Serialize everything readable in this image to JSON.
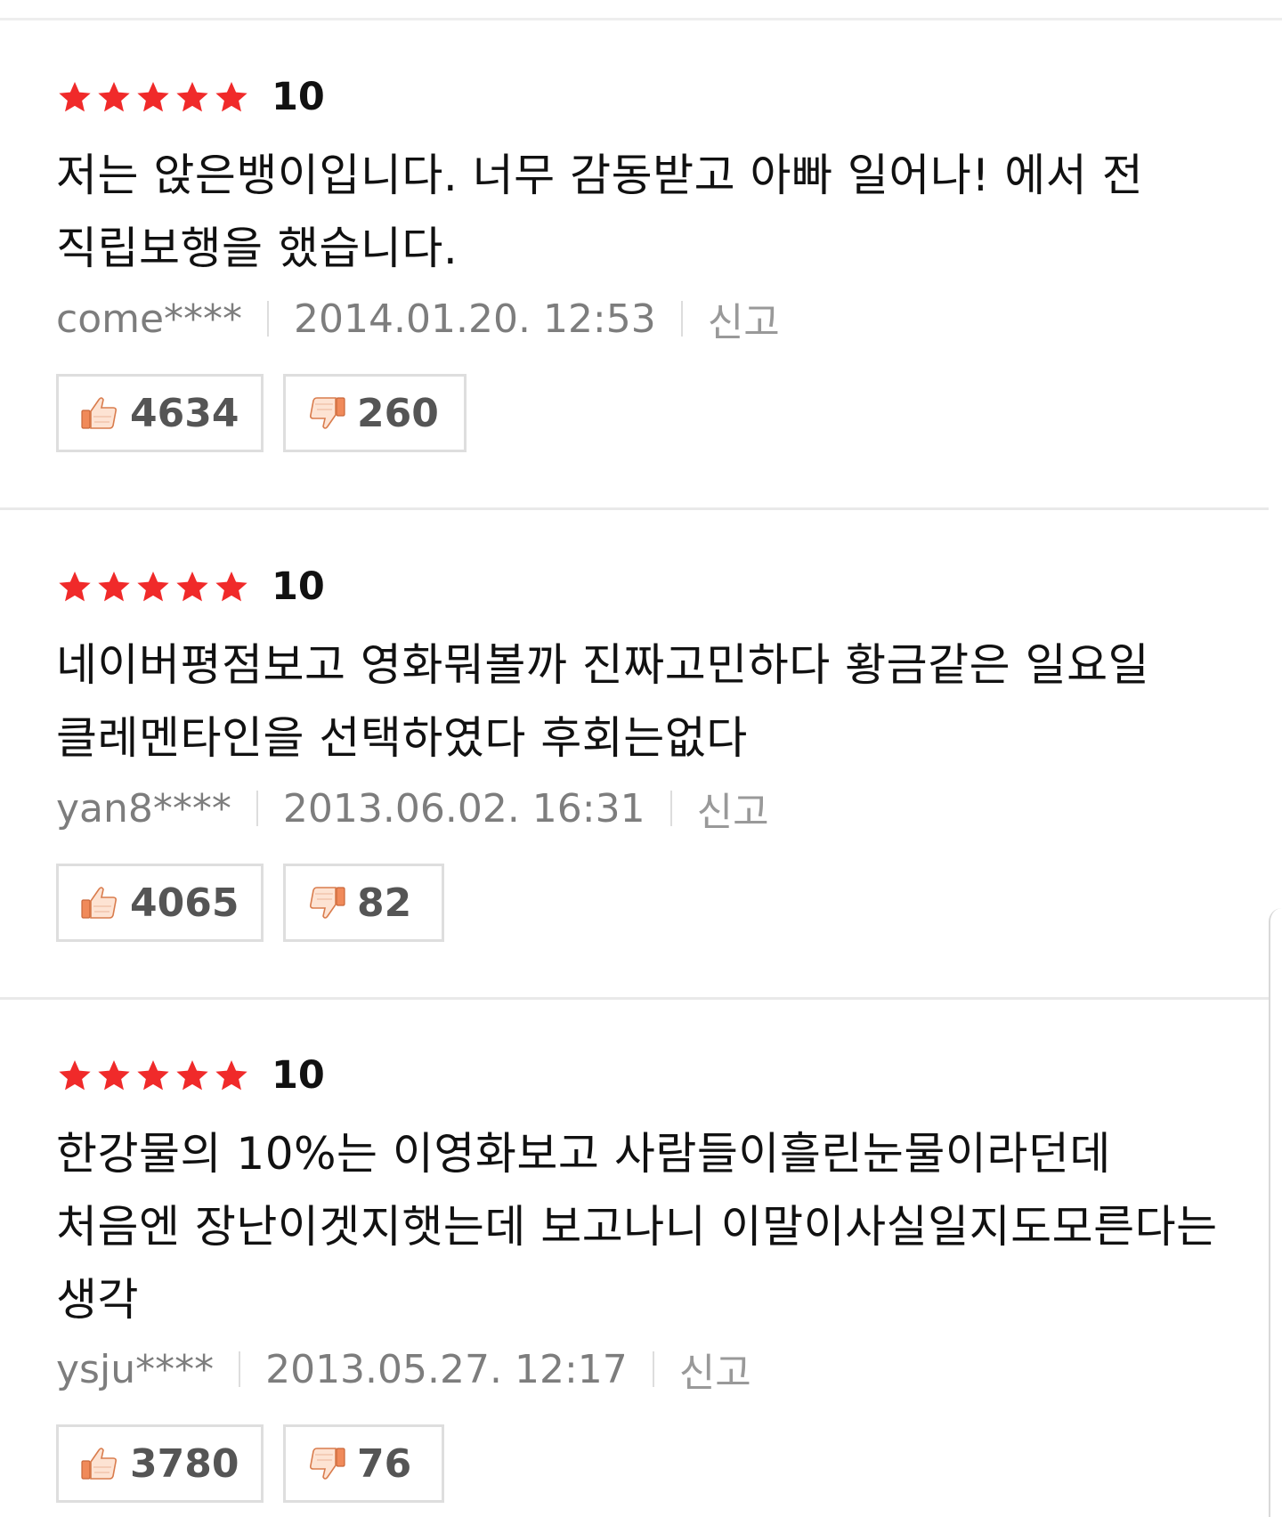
{
  "colors": {
    "star": "#f02a2a",
    "text": "#111111",
    "meta": "#7d7d7d",
    "thumb": "#f08a5a"
  },
  "icons": {
    "star": "star-icon",
    "like": "thumbs-up-icon",
    "dislike": "thumbs-down-icon"
  },
  "reviews": [
    {
      "stars": 5,
      "score": "10",
      "comment": "저는 앉은뱅이입니다. 너무 감동받고 아빠 일어나! 에서 전 직립보행을 했습니다.",
      "user": "come****",
      "date": "2014.01.20. 12:53",
      "report": "신고",
      "likes": "4634",
      "dislikes": "260"
    },
    {
      "stars": 5,
      "score": "10",
      "comment": "네이버평점보고 영화뭐볼까 진짜고민하다 황금같은 일요일 클레멘타인을 선택하였다 후회는없다",
      "user": "yan8****",
      "date": "2013.06.02. 16:31",
      "report": "신고",
      "likes": "4065",
      "dislikes": "82"
    },
    {
      "stars": 5,
      "score": "10",
      "comment": "한강물의 10%는 이영화보고 사람들이흘린눈물이라던데 처음엔 장난이겟지햇는데 보고나니 이말이사실일지도모른다는 생각",
      "user": "ysju****",
      "date": "2013.05.27. 12:17",
      "report": "신고",
      "likes": "3780",
      "dislikes": "76"
    }
  ]
}
